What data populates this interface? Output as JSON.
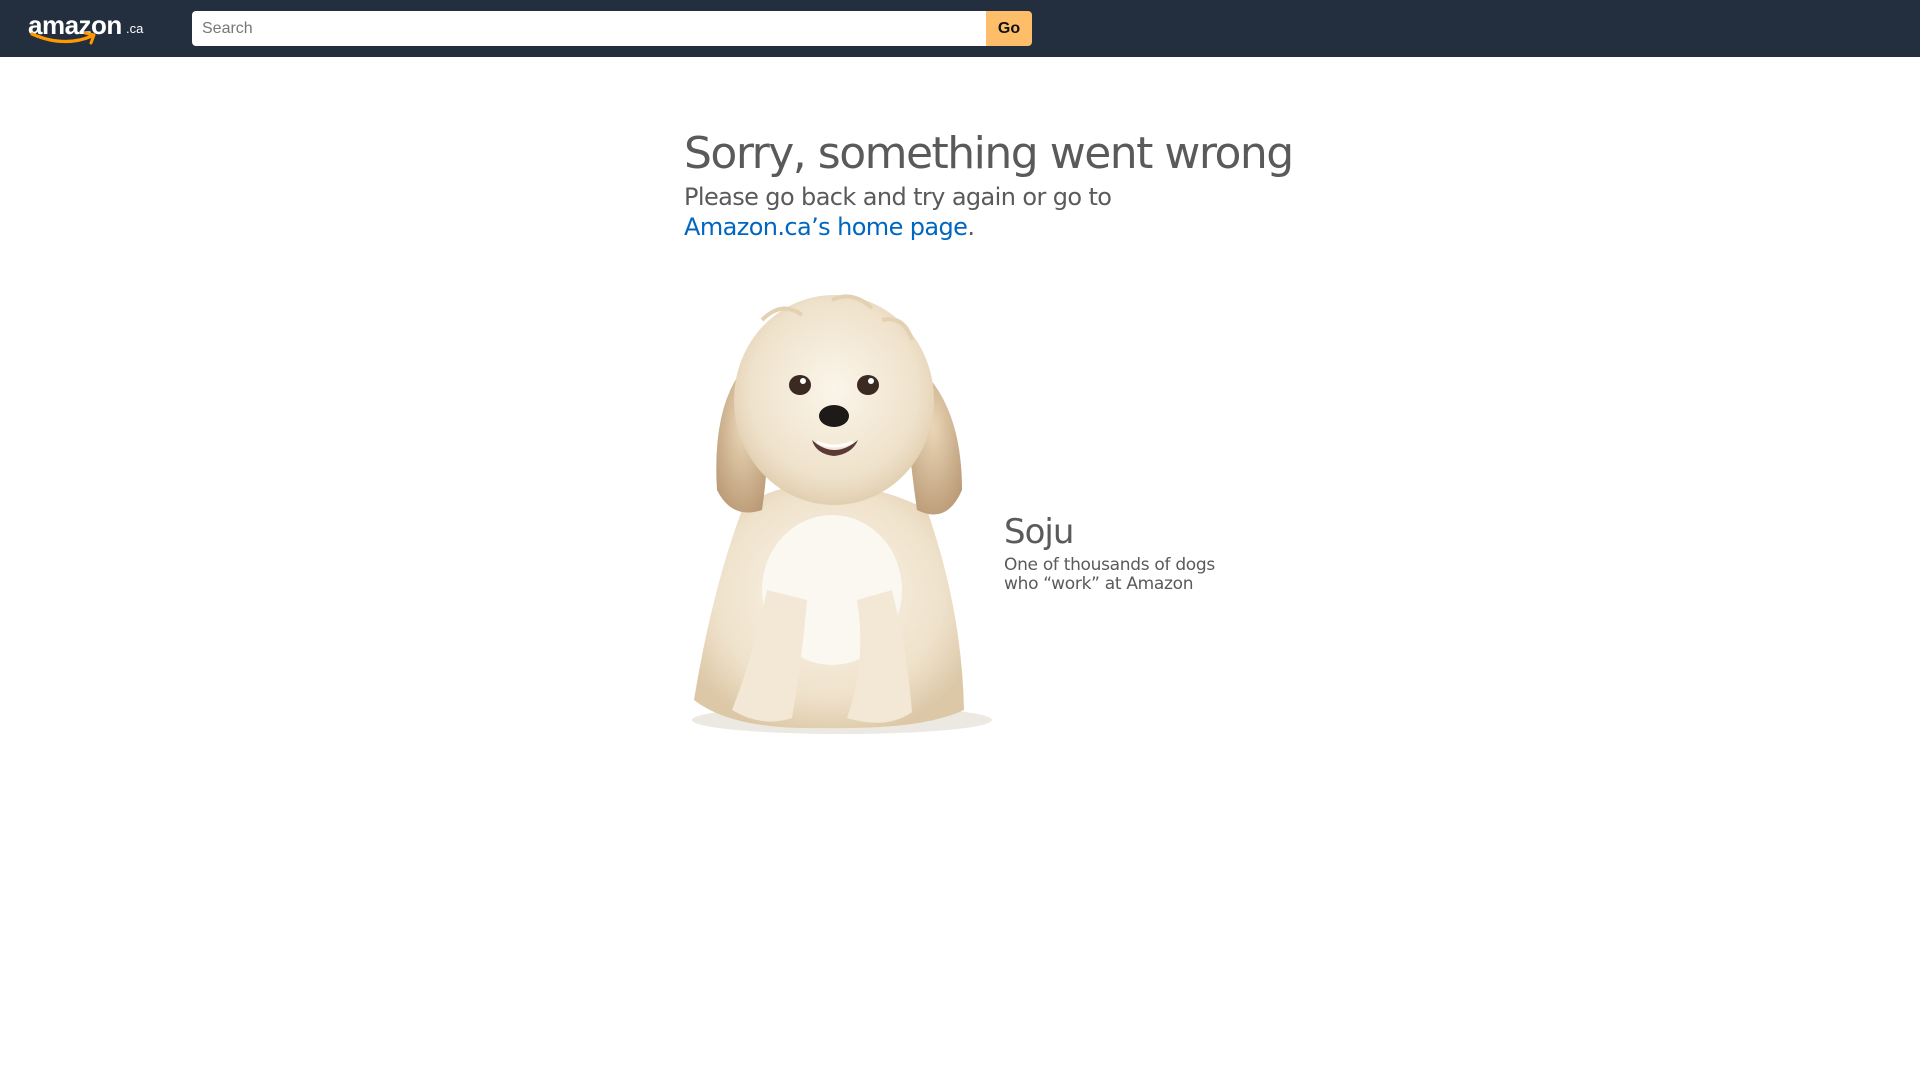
{
  "header": {
    "logo": {
      "word": "amazon",
      "tld": ".ca"
    },
    "search": {
      "placeholder": "Search",
      "value": ""
    },
    "go_label": "Go"
  },
  "main": {
    "title": "Sorry, something went wrong",
    "subtitle_text": "Please go back and try again or go to",
    "home_link": "Amazon.ca’s home page",
    "home_link_suffix": ".",
    "dog": {
      "name": "Soju",
      "caption_line1": "One of thousands of dogs",
      "caption_line2": "who “work” at Amazon"
    }
  },
  "colors": {
    "header_bg": "#232f3e",
    "go_button": "#febd69",
    "link": "#0066c0",
    "text": "#5a5a5a"
  }
}
